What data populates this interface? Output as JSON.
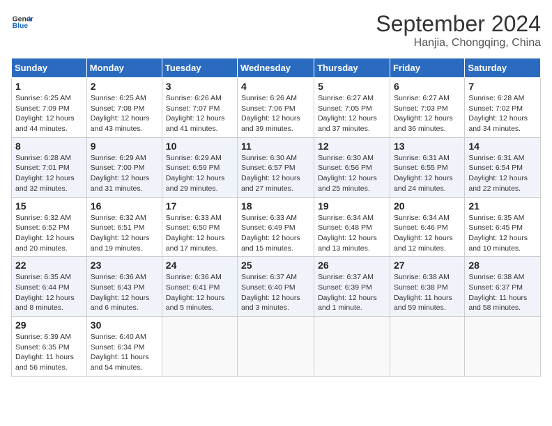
{
  "header": {
    "logo_line1": "General",
    "logo_line2": "Blue",
    "month_title": "September 2024",
    "subtitle": "Hanjia, Chongqing, China"
  },
  "weekdays": [
    "Sunday",
    "Monday",
    "Tuesday",
    "Wednesday",
    "Thursday",
    "Friday",
    "Saturday"
  ],
  "weeks": [
    [
      {
        "day": "1",
        "info": "Sunrise: 6:25 AM\nSunset: 7:09 PM\nDaylight: 12 hours\nand 44 minutes."
      },
      {
        "day": "2",
        "info": "Sunrise: 6:25 AM\nSunset: 7:08 PM\nDaylight: 12 hours\nand 43 minutes."
      },
      {
        "day": "3",
        "info": "Sunrise: 6:26 AM\nSunset: 7:07 PM\nDaylight: 12 hours\nand 41 minutes."
      },
      {
        "day": "4",
        "info": "Sunrise: 6:26 AM\nSunset: 7:06 PM\nDaylight: 12 hours\nand 39 minutes."
      },
      {
        "day": "5",
        "info": "Sunrise: 6:27 AM\nSunset: 7:05 PM\nDaylight: 12 hours\nand 37 minutes."
      },
      {
        "day": "6",
        "info": "Sunrise: 6:27 AM\nSunset: 7:03 PM\nDaylight: 12 hours\nand 36 minutes."
      },
      {
        "day": "7",
        "info": "Sunrise: 6:28 AM\nSunset: 7:02 PM\nDaylight: 12 hours\nand 34 minutes."
      }
    ],
    [
      {
        "day": "8",
        "info": "Sunrise: 6:28 AM\nSunset: 7:01 PM\nDaylight: 12 hours\nand 32 minutes."
      },
      {
        "day": "9",
        "info": "Sunrise: 6:29 AM\nSunset: 7:00 PM\nDaylight: 12 hours\nand 31 minutes."
      },
      {
        "day": "10",
        "info": "Sunrise: 6:29 AM\nSunset: 6:59 PM\nDaylight: 12 hours\nand 29 minutes."
      },
      {
        "day": "11",
        "info": "Sunrise: 6:30 AM\nSunset: 6:57 PM\nDaylight: 12 hours\nand 27 minutes."
      },
      {
        "day": "12",
        "info": "Sunrise: 6:30 AM\nSunset: 6:56 PM\nDaylight: 12 hours\nand 25 minutes."
      },
      {
        "day": "13",
        "info": "Sunrise: 6:31 AM\nSunset: 6:55 PM\nDaylight: 12 hours\nand 24 minutes."
      },
      {
        "day": "14",
        "info": "Sunrise: 6:31 AM\nSunset: 6:54 PM\nDaylight: 12 hours\nand 22 minutes."
      }
    ],
    [
      {
        "day": "15",
        "info": "Sunrise: 6:32 AM\nSunset: 6:52 PM\nDaylight: 12 hours\nand 20 minutes."
      },
      {
        "day": "16",
        "info": "Sunrise: 6:32 AM\nSunset: 6:51 PM\nDaylight: 12 hours\nand 19 minutes."
      },
      {
        "day": "17",
        "info": "Sunrise: 6:33 AM\nSunset: 6:50 PM\nDaylight: 12 hours\nand 17 minutes."
      },
      {
        "day": "18",
        "info": "Sunrise: 6:33 AM\nSunset: 6:49 PM\nDaylight: 12 hours\nand 15 minutes."
      },
      {
        "day": "19",
        "info": "Sunrise: 6:34 AM\nSunset: 6:48 PM\nDaylight: 12 hours\nand 13 minutes."
      },
      {
        "day": "20",
        "info": "Sunrise: 6:34 AM\nSunset: 6:46 PM\nDaylight: 12 hours\nand 12 minutes."
      },
      {
        "day": "21",
        "info": "Sunrise: 6:35 AM\nSunset: 6:45 PM\nDaylight: 12 hours\nand 10 minutes."
      }
    ],
    [
      {
        "day": "22",
        "info": "Sunrise: 6:35 AM\nSunset: 6:44 PM\nDaylight: 12 hours\nand 8 minutes."
      },
      {
        "day": "23",
        "info": "Sunrise: 6:36 AM\nSunset: 6:43 PM\nDaylight: 12 hours\nand 6 minutes."
      },
      {
        "day": "24",
        "info": "Sunrise: 6:36 AM\nSunset: 6:41 PM\nDaylight: 12 hours\nand 5 minutes."
      },
      {
        "day": "25",
        "info": "Sunrise: 6:37 AM\nSunset: 6:40 PM\nDaylight: 12 hours\nand 3 minutes."
      },
      {
        "day": "26",
        "info": "Sunrise: 6:37 AM\nSunset: 6:39 PM\nDaylight: 12 hours\nand 1 minute."
      },
      {
        "day": "27",
        "info": "Sunrise: 6:38 AM\nSunset: 6:38 PM\nDaylight: 11 hours\nand 59 minutes."
      },
      {
        "day": "28",
        "info": "Sunrise: 6:38 AM\nSunset: 6:37 PM\nDaylight: 11 hours\nand 58 minutes."
      }
    ],
    [
      {
        "day": "29",
        "info": "Sunrise: 6:39 AM\nSunset: 6:35 PM\nDaylight: 11 hours\nand 56 minutes."
      },
      {
        "day": "30",
        "info": "Sunrise: 6:40 AM\nSunset: 6:34 PM\nDaylight: 11 hours\nand 54 minutes."
      },
      {
        "day": "",
        "info": ""
      },
      {
        "day": "",
        "info": ""
      },
      {
        "day": "",
        "info": ""
      },
      {
        "day": "",
        "info": ""
      },
      {
        "day": "",
        "info": ""
      }
    ]
  ]
}
